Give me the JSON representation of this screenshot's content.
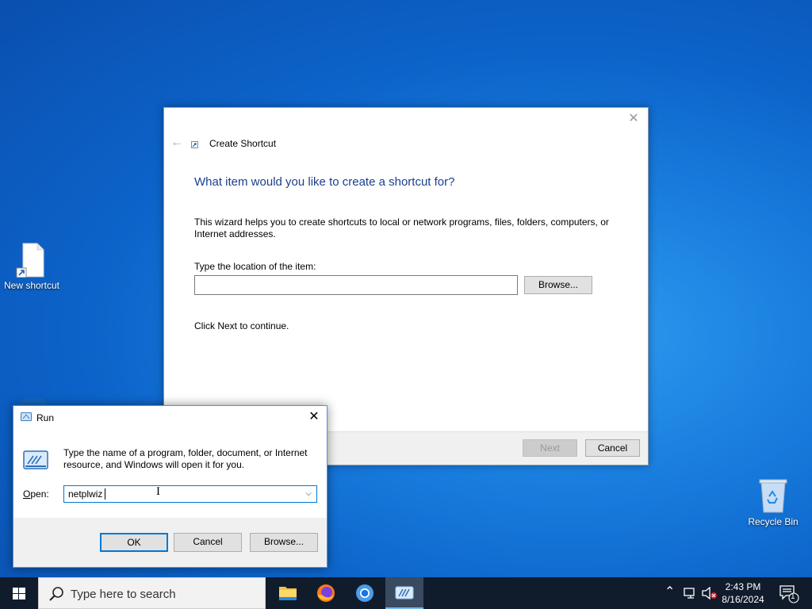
{
  "desktop": {
    "icons": [
      {
        "label": "New shortcut"
      },
      {
        "label": "Recycle Bin"
      }
    ],
    "background_colors": [
      "#0a4fae",
      "#2f9cf0"
    ]
  },
  "wizard": {
    "window_title": "Create Shortcut",
    "heading": "What item would you like to create a shortcut for?",
    "description": "This wizard helps you to create shortcuts to local or network programs, files, folders, computers, or Internet addresses.",
    "location_label": "Type the location of the item:",
    "location_value": "",
    "browse_label": "Browse...",
    "continue_text": "Click Next to continue.",
    "next_label": "Next",
    "cancel_label": "Cancel",
    "close_glyph": "✕",
    "back_glyph": "←"
  },
  "run": {
    "title": "Run",
    "description": "Type the name of a program, folder, document, or Internet resource, and Windows will open it for you.",
    "open_label_accel": "O",
    "open_label_rest": "pen:",
    "open_value": "netplwiz",
    "ok_label": "OK",
    "cancel_label": "Cancel",
    "browse_label": "Browse...",
    "close_glyph": "✕",
    "dropdown_glyph": "⌵"
  },
  "taskbar": {
    "search_placeholder": "Type here to search",
    "apps": [
      "file-explorer",
      "firefox",
      "chrome",
      "run"
    ],
    "tray_chevron": "⌃",
    "time": "2:43 PM",
    "date": "8/16/2024",
    "notification_count": "1",
    "accent": "#76b9ed"
  }
}
